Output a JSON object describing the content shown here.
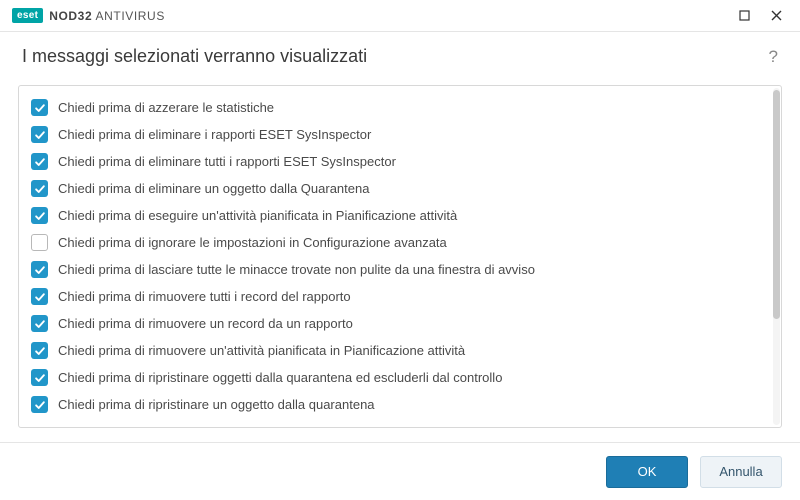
{
  "brand": {
    "badge": "eset",
    "product_prefix": "NOD32",
    "product_suffix": "ANTIVIRUS"
  },
  "header": {
    "title": "I messaggi selezionati verranno visualizzati"
  },
  "options": [
    {
      "label": "Chiedi prima di azzerare le statistiche",
      "checked": true
    },
    {
      "label": "Chiedi prima di eliminare i rapporti ESET SysInspector",
      "checked": true
    },
    {
      "label": "Chiedi prima di eliminare tutti i rapporti ESET SysInspector",
      "checked": true
    },
    {
      "label": "Chiedi prima di eliminare un oggetto dalla Quarantena",
      "checked": true
    },
    {
      "label": "Chiedi prima di eseguire un'attività pianificata in Pianificazione attività",
      "checked": true
    },
    {
      "label": "Chiedi prima di ignorare le impostazioni in Configurazione avanzata",
      "checked": false
    },
    {
      "label": "Chiedi prima di lasciare tutte le minacce trovate non pulite da una finestra di avviso",
      "checked": true
    },
    {
      "label": "Chiedi prima di rimuovere tutti i record del rapporto",
      "checked": true
    },
    {
      "label": "Chiedi prima di rimuovere un record da un rapporto",
      "checked": true
    },
    {
      "label": "Chiedi prima di rimuovere un'attività pianificata in Pianificazione attività",
      "checked": true
    },
    {
      "label": "Chiedi prima di ripristinare oggetti dalla quarantena ed escluderli dal controllo",
      "checked": true
    },
    {
      "label": "Chiedi prima di ripristinare un oggetto dalla quarantena",
      "checked": true
    }
  ],
  "footer": {
    "ok_label": "OK",
    "cancel_label": "Annulla"
  }
}
